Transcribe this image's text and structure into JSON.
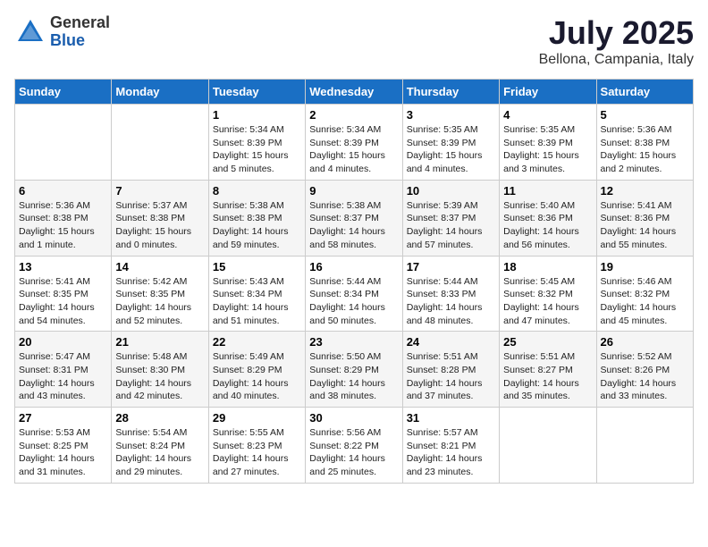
{
  "logo": {
    "general": "General",
    "blue": "Blue"
  },
  "title": "July 2025",
  "location": "Bellona, Campania, Italy",
  "days_of_week": [
    "Sunday",
    "Monday",
    "Tuesday",
    "Wednesday",
    "Thursday",
    "Friday",
    "Saturday"
  ],
  "weeks": [
    [
      {
        "day": "",
        "info": ""
      },
      {
        "day": "",
        "info": ""
      },
      {
        "day": "1",
        "info": "Sunrise: 5:34 AM\nSunset: 8:39 PM\nDaylight: 15 hours and 5 minutes."
      },
      {
        "day": "2",
        "info": "Sunrise: 5:34 AM\nSunset: 8:39 PM\nDaylight: 15 hours and 4 minutes."
      },
      {
        "day": "3",
        "info": "Sunrise: 5:35 AM\nSunset: 8:39 PM\nDaylight: 15 hours and 4 minutes."
      },
      {
        "day": "4",
        "info": "Sunrise: 5:35 AM\nSunset: 8:39 PM\nDaylight: 15 hours and 3 minutes."
      },
      {
        "day": "5",
        "info": "Sunrise: 5:36 AM\nSunset: 8:38 PM\nDaylight: 15 hours and 2 minutes."
      }
    ],
    [
      {
        "day": "6",
        "info": "Sunrise: 5:36 AM\nSunset: 8:38 PM\nDaylight: 15 hours and 1 minute."
      },
      {
        "day": "7",
        "info": "Sunrise: 5:37 AM\nSunset: 8:38 PM\nDaylight: 15 hours and 0 minutes."
      },
      {
        "day": "8",
        "info": "Sunrise: 5:38 AM\nSunset: 8:38 PM\nDaylight: 14 hours and 59 minutes."
      },
      {
        "day": "9",
        "info": "Sunrise: 5:38 AM\nSunset: 8:37 PM\nDaylight: 14 hours and 58 minutes."
      },
      {
        "day": "10",
        "info": "Sunrise: 5:39 AM\nSunset: 8:37 PM\nDaylight: 14 hours and 57 minutes."
      },
      {
        "day": "11",
        "info": "Sunrise: 5:40 AM\nSunset: 8:36 PM\nDaylight: 14 hours and 56 minutes."
      },
      {
        "day": "12",
        "info": "Sunrise: 5:41 AM\nSunset: 8:36 PM\nDaylight: 14 hours and 55 minutes."
      }
    ],
    [
      {
        "day": "13",
        "info": "Sunrise: 5:41 AM\nSunset: 8:35 PM\nDaylight: 14 hours and 54 minutes."
      },
      {
        "day": "14",
        "info": "Sunrise: 5:42 AM\nSunset: 8:35 PM\nDaylight: 14 hours and 52 minutes."
      },
      {
        "day": "15",
        "info": "Sunrise: 5:43 AM\nSunset: 8:34 PM\nDaylight: 14 hours and 51 minutes."
      },
      {
        "day": "16",
        "info": "Sunrise: 5:44 AM\nSunset: 8:34 PM\nDaylight: 14 hours and 50 minutes."
      },
      {
        "day": "17",
        "info": "Sunrise: 5:44 AM\nSunset: 8:33 PM\nDaylight: 14 hours and 48 minutes."
      },
      {
        "day": "18",
        "info": "Sunrise: 5:45 AM\nSunset: 8:32 PM\nDaylight: 14 hours and 47 minutes."
      },
      {
        "day": "19",
        "info": "Sunrise: 5:46 AM\nSunset: 8:32 PM\nDaylight: 14 hours and 45 minutes."
      }
    ],
    [
      {
        "day": "20",
        "info": "Sunrise: 5:47 AM\nSunset: 8:31 PM\nDaylight: 14 hours and 43 minutes."
      },
      {
        "day": "21",
        "info": "Sunrise: 5:48 AM\nSunset: 8:30 PM\nDaylight: 14 hours and 42 minutes."
      },
      {
        "day": "22",
        "info": "Sunrise: 5:49 AM\nSunset: 8:29 PM\nDaylight: 14 hours and 40 minutes."
      },
      {
        "day": "23",
        "info": "Sunrise: 5:50 AM\nSunset: 8:29 PM\nDaylight: 14 hours and 38 minutes."
      },
      {
        "day": "24",
        "info": "Sunrise: 5:51 AM\nSunset: 8:28 PM\nDaylight: 14 hours and 37 minutes."
      },
      {
        "day": "25",
        "info": "Sunrise: 5:51 AM\nSunset: 8:27 PM\nDaylight: 14 hours and 35 minutes."
      },
      {
        "day": "26",
        "info": "Sunrise: 5:52 AM\nSunset: 8:26 PM\nDaylight: 14 hours and 33 minutes."
      }
    ],
    [
      {
        "day": "27",
        "info": "Sunrise: 5:53 AM\nSunset: 8:25 PM\nDaylight: 14 hours and 31 minutes."
      },
      {
        "day": "28",
        "info": "Sunrise: 5:54 AM\nSunset: 8:24 PM\nDaylight: 14 hours and 29 minutes."
      },
      {
        "day": "29",
        "info": "Sunrise: 5:55 AM\nSunset: 8:23 PM\nDaylight: 14 hours and 27 minutes."
      },
      {
        "day": "30",
        "info": "Sunrise: 5:56 AM\nSunset: 8:22 PM\nDaylight: 14 hours and 25 minutes."
      },
      {
        "day": "31",
        "info": "Sunrise: 5:57 AM\nSunset: 8:21 PM\nDaylight: 14 hours and 23 minutes."
      },
      {
        "day": "",
        "info": ""
      },
      {
        "day": "",
        "info": ""
      }
    ]
  ]
}
